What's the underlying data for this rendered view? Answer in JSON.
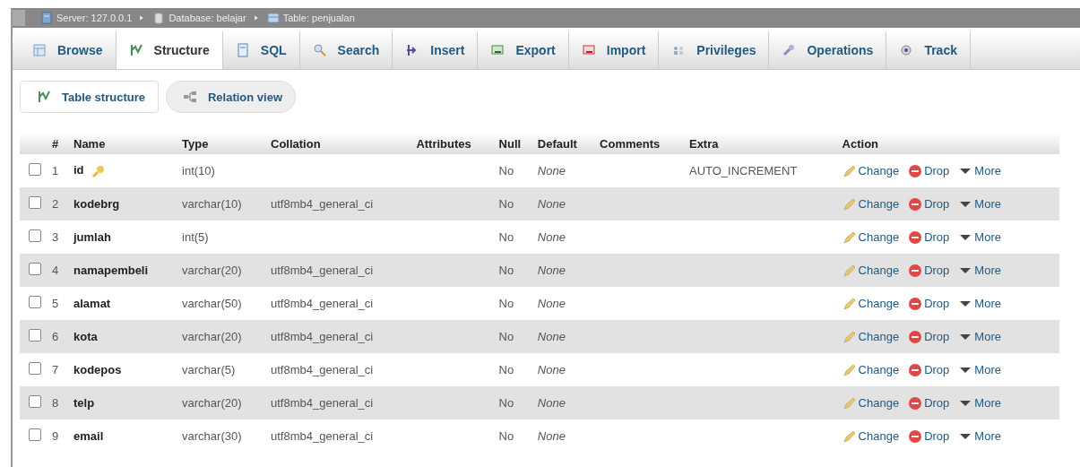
{
  "breadcrumb": [
    {
      "kind": "server",
      "label": "Server: 127.0.0.1"
    },
    {
      "kind": "database",
      "label": "Database: belajar"
    },
    {
      "kind": "table",
      "label": "Table: penjualan"
    }
  ],
  "tabs": [
    {
      "kind": "browse",
      "label": "Browse",
      "selected": false
    },
    {
      "kind": "structure",
      "label": "Structure",
      "selected": true
    },
    {
      "kind": "sql",
      "label": "SQL",
      "selected": false
    },
    {
      "kind": "search",
      "label": "Search",
      "selected": false
    },
    {
      "kind": "insert",
      "label": "Insert",
      "selected": false
    },
    {
      "kind": "export",
      "label": "Export",
      "selected": false
    },
    {
      "kind": "import",
      "label": "Import",
      "selected": false
    },
    {
      "kind": "privileges",
      "label": "Privileges",
      "selected": false
    },
    {
      "kind": "operations",
      "label": "Operations",
      "selected": false
    },
    {
      "kind": "tracking",
      "label": "Track",
      "selected": false
    }
  ],
  "subtabs": [
    {
      "kind": "structure",
      "label": "Table structure",
      "selected": true
    },
    {
      "kind": "relation",
      "label": "Relation view",
      "selected": false
    }
  ],
  "table": {
    "columns": [
      "#",
      "Name",
      "Type",
      "Collation",
      "Attributes",
      "Null",
      "Default",
      "Comments",
      "Extra",
      "Action"
    ],
    "rows": [
      {
        "num": "1",
        "name": "id",
        "primary": true,
        "type": "int(10)",
        "collation": "",
        "null": "No",
        "default": "None",
        "extra": "AUTO_INCREMENT",
        "checked": false,
        "actions": [
          {
            "kind": "change",
            "label": "Change"
          },
          {
            "kind": "drop",
            "label": "Drop"
          },
          {
            "kind": "more",
            "label": "More"
          }
        ]
      },
      {
        "num": "2",
        "name": "kodebrg",
        "primary": false,
        "type": "varchar(10)",
        "collation": "utf8mb4_general_ci",
        "null": "No",
        "default": "None",
        "extra": "",
        "checked": false,
        "actions": [
          {
            "kind": "change",
            "label": "Change"
          },
          {
            "kind": "drop",
            "label": "Drop"
          },
          {
            "kind": "more",
            "label": "More"
          }
        ]
      },
      {
        "num": "3",
        "name": "jumlah",
        "primary": false,
        "type": "int(5)",
        "collation": "",
        "null": "No",
        "default": "None",
        "extra": "",
        "checked": false,
        "actions": [
          {
            "kind": "change",
            "label": "Change"
          },
          {
            "kind": "drop",
            "label": "Drop"
          },
          {
            "kind": "more",
            "label": "More"
          }
        ]
      },
      {
        "num": "4",
        "name": "namapembeli",
        "primary": false,
        "type": "varchar(20)",
        "collation": "utf8mb4_general_ci",
        "null": "No",
        "default": "None",
        "extra": "",
        "checked": false,
        "actions": [
          {
            "kind": "change",
            "label": "Change"
          },
          {
            "kind": "drop",
            "label": "Drop"
          },
          {
            "kind": "more",
            "label": "More"
          }
        ]
      },
      {
        "num": "5",
        "name": "alamat",
        "primary": false,
        "type": "varchar(50)",
        "collation": "utf8mb4_general_ci",
        "null": "No",
        "default": "None",
        "extra": "",
        "checked": false,
        "actions": [
          {
            "kind": "change",
            "label": "Change"
          },
          {
            "kind": "drop",
            "label": "Drop"
          },
          {
            "kind": "more",
            "label": "More"
          }
        ]
      },
      {
        "num": "6",
        "name": "kota",
        "primary": false,
        "type": "varchar(20)",
        "collation": "utf8mb4_general_ci",
        "null": "No",
        "default": "None",
        "extra": "",
        "checked": false,
        "actions": [
          {
            "kind": "change",
            "label": "Change"
          },
          {
            "kind": "drop",
            "label": "Drop"
          },
          {
            "kind": "more",
            "label": "More"
          }
        ]
      },
      {
        "num": "7",
        "name": "kodepos",
        "primary": false,
        "type": "varchar(5)",
        "collation": "utf8mb4_general_ci",
        "null": "No",
        "default": "None",
        "extra": "",
        "checked": false,
        "actions": [
          {
            "kind": "change",
            "label": "Change"
          },
          {
            "kind": "drop",
            "label": "Drop"
          },
          {
            "kind": "more",
            "label": "More"
          }
        ]
      },
      {
        "num": "8",
        "name": "telp",
        "primary": false,
        "type": "varchar(20)",
        "collation": "utf8mb4_general_ci",
        "null": "No",
        "default": "None",
        "extra": "",
        "checked": false,
        "actions": [
          {
            "kind": "change",
            "label": "Change"
          },
          {
            "kind": "drop",
            "label": "Drop"
          },
          {
            "kind": "more",
            "label": "More"
          }
        ]
      },
      {
        "num": "9",
        "name": "email",
        "primary": false,
        "type": "varchar(30)",
        "collation": "utf8mb4_general_ci",
        "null": "No",
        "default": "None",
        "extra": "",
        "checked": false,
        "actions": [
          {
            "kind": "change",
            "label": "Change"
          },
          {
            "kind": "drop",
            "label": "Drop"
          },
          {
            "kind": "more",
            "label": "More"
          }
        ]
      }
    ]
  }
}
